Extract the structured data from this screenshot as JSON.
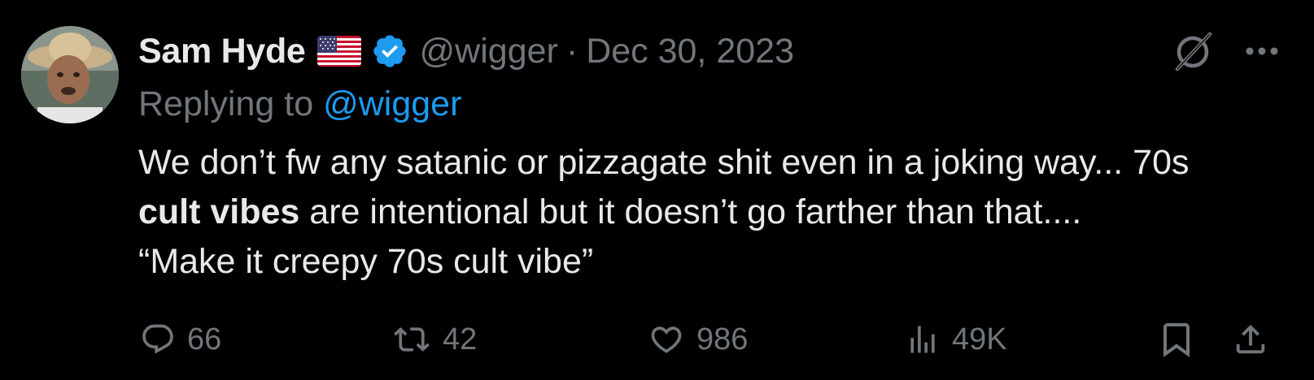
{
  "tweet": {
    "author": {
      "name": "Sam Hyde",
      "handle": "@wigger",
      "flag_icon": "us-flag-icon",
      "verified_icon": "verified-badge-icon"
    },
    "separator": "·",
    "date": "Dec 30, 2023",
    "reply": {
      "label": "Replying to",
      "handle": "@wigger"
    },
    "text": {
      "line1": "We don’t fw any satanic or pizzagate shit even in a joking way... 70s",
      "line2_bold": "cult vibes",
      "line2_rest": " are intentional but it doesn’t go farther than that....",
      "line3": "“Make it creepy 70s cult vibe”"
    },
    "stats": {
      "replies": "66",
      "retweets": "42",
      "likes": "986",
      "views": "49K"
    }
  },
  "icons": {
    "grok": "grok-icon",
    "more": "more-icon",
    "reply": "reply-icon",
    "retweet": "retweet-icon",
    "like": "heart-icon",
    "views": "views-icon",
    "bookmark": "bookmark-icon",
    "share": "share-icon"
  },
  "colors": {
    "background": "#000000",
    "primary_text": "#e7e9ea",
    "secondary_text": "#71767b",
    "link": "#1d9bf0",
    "verified": "#1d9bf0"
  }
}
